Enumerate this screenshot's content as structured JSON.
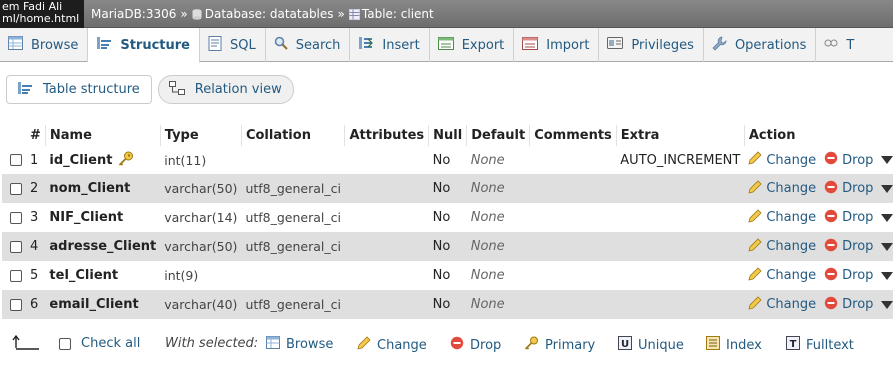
{
  "tooltip": {
    "line1": "em Fadi Ali",
    "line2": "ml/home.html"
  },
  "breadcrumb": {
    "server": "MariaDB:3306",
    "sep": "»",
    "database": "Database: datatables",
    "table": "Table: client"
  },
  "tabs": [
    {
      "label": "Browse",
      "icon": "browse-icon"
    },
    {
      "label": "Structure",
      "icon": "structure-icon",
      "active": true
    },
    {
      "label": "SQL",
      "icon": "sql-icon"
    },
    {
      "label": "Search",
      "icon": "search-icon"
    },
    {
      "label": "Insert",
      "icon": "insert-icon"
    },
    {
      "label": "Export",
      "icon": "export-icon"
    },
    {
      "label": "Import",
      "icon": "import-icon"
    },
    {
      "label": "Privileges",
      "icon": "privileges-icon"
    },
    {
      "label": "Operations",
      "icon": "wrench-icon"
    },
    {
      "label": "T",
      "icon": "tracking-icon"
    }
  ],
  "subtabs": {
    "table_structure": "Table structure",
    "relation_view": "Relation view"
  },
  "columns": {
    "num": "#",
    "name": "Name",
    "type": "Type",
    "collation": "Collation",
    "attributes": "Attributes",
    "null": "Null",
    "default": "Default",
    "comments": "Comments",
    "extra": "Extra",
    "action": "Action"
  },
  "rows": [
    {
      "num": "1",
      "name": "id_Client",
      "type": "int(11)",
      "collation": "",
      "null": "No",
      "default": "None",
      "extra": "AUTO_INCREMENT",
      "primary": true
    },
    {
      "num": "2",
      "name": "nom_Client",
      "type": "varchar(50)",
      "collation": "utf8_general_ci",
      "null": "No",
      "default": "None",
      "extra": ""
    },
    {
      "num": "3",
      "name": "NIF_Client",
      "type": "varchar(14)",
      "collation": "utf8_general_ci",
      "null": "No",
      "default": "None",
      "extra": ""
    },
    {
      "num": "4",
      "name": "adresse_Client",
      "type": "varchar(50)",
      "collation": "utf8_general_ci",
      "null": "No",
      "default": "None",
      "extra": ""
    },
    {
      "num": "5",
      "name": "tel_Client",
      "type": "int(9)",
      "collation": "",
      "null": "No",
      "default": "None",
      "extra": ""
    },
    {
      "num": "6",
      "name": "email_Client",
      "type": "varchar(40)",
      "collation": "utf8_general_ci",
      "null": "No",
      "default": "None",
      "extra": ""
    }
  ],
  "row_actions": {
    "change": "Change",
    "drop": "Drop",
    "more": "More"
  },
  "bottom": {
    "check_all": "Check all",
    "with_selected": "With selected:",
    "browse": "Browse",
    "change": "Change",
    "drop": "Drop",
    "primary": "Primary",
    "unique": "Unique",
    "index": "Index",
    "fulltext": "Fulltext"
  },
  "colors": {
    "link": "#235a81",
    "row_alt": "#dfdfdf",
    "topbar": "#777777"
  }
}
